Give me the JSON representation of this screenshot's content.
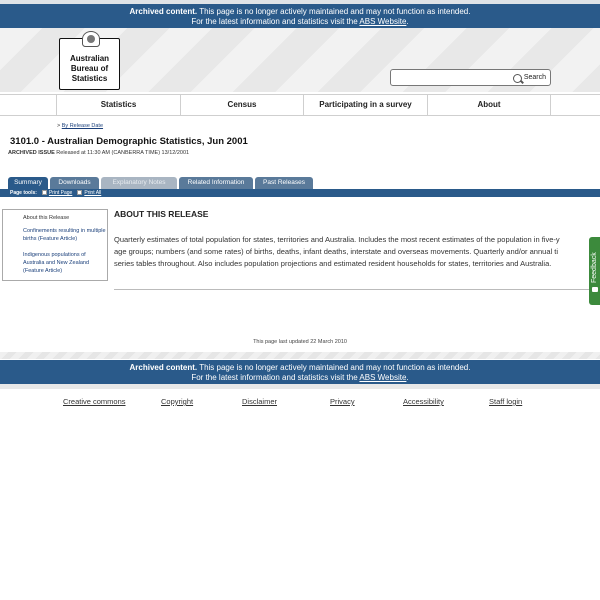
{
  "archive_banner": {
    "bold": "Archived content.",
    "text": " This page is no longer actively maintained and may not function as intended.",
    "line2_prefix": "For the latest information and statistics visit the ",
    "link": "ABS Website",
    "line2_suffix": "."
  },
  "logo": {
    "line1": "Australian",
    "line2": "Bureau of",
    "line3": "Statistics"
  },
  "search": {
    "placeholder": "",
    "button_label": "Search"
  },
  "nav": {
    "items": [
      {
        "label": "Statistics"
      },
      {
        "label": "Census"
      },
      {
        "label": "Participating in a survey"
      },
      {
        "label": "About"
      }
    ]
  },
  "breadcrumb": {
    "separator": ">",
    "link": "By Release Date"
  },
  "page": {
    "title": "3101.0 - Australian Demographic Statistics, Jun 2001",
    "issue_label": "ARCHIVED ISSUE",
    "issue_text": " Released at 11:30 AM (CANBERRA TIME) 13/12/2001"
  },
  "tabs": [
    {
      "label": "Summary"
    },
    {
      "label": "Downloads"
    },
    {
      "label": "Explanatory Notes"
    },
    {
      "label": "Related Information"
    },
    {
      "label": "Past Releases"
    }
  ],
  "page_tools": {
    "label": "Page tools:",
    "print_page": "Print Page",
    "print_all": "Print All"
  },
  "sidebar": {
    "items": [
      {
        "label": "About this Release"
      },
      {
        "label": "Confinements resulting in multiple births (Feature Article)"
      },
      {
        "label": "Indigenous populations of Australia and New Zealand (Feature Article)"
      }
    ]
  },
  "content": {
    "heading": "ABOUT THIS RELEASE",
    "line1": "Quarterly estimates of total population for states, territories and Australia. Includes the most recent estimates of the population in five-y",
    "line2": "age groups; numbers (and some rates) of births, deaths, infant deaths, interstate and overseas movements. Quarterly and/or annual ti",
    "line3": "series tables throughout. Also includes population projections and estimated resident households for states, territories and Australia."
  },
  "feedback": {
    "label": "Feedback"
  },
  "last_updated": "This page last updated 22 March 2010",
  "footer": {
    "links": [
      {
        "label": "Creative commons"
      },
      {
        "label": "Copyright"
      },
      {
        "label": "Disclaimer"
      },
      {
        "label": "Privacy"
      },
      {
        "label": "Accessibility"
      },
      {
        "label": "Staff login"
      }
    ]
  },
  "colors": {
    "banner": "#2a5a8a",
    "tab_active": "#2a5a8a",
    "link": "#1a3f7a",
    "feedback": "#3c8a3c"
  }
}
